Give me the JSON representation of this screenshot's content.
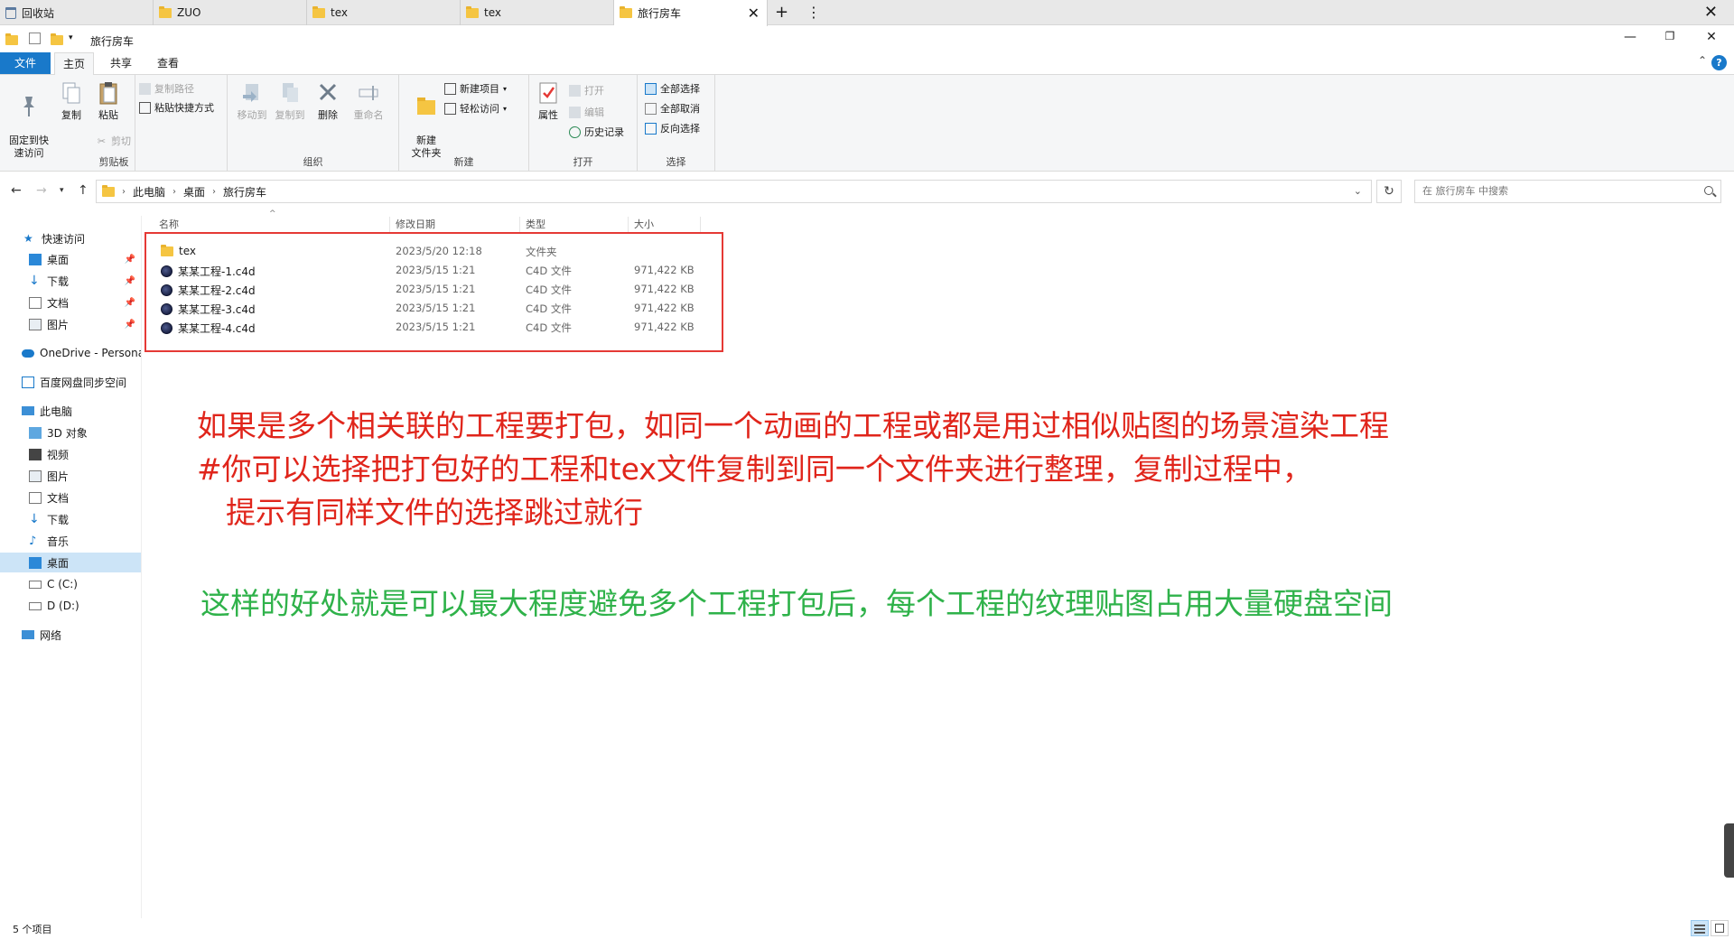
{
  "tabs": [
    {
      "label": "回收站",
      "icon": "recycle-bin-icon"
    },
    {
      "label": "ZUO",
      "icon": "folder-icon"
    },
    {
      "label": "tex",
      "icon": "folder-icon"
    },
    {
      "label": "tex",
      "icon": "folder-icon"
    },
    {
      "label": "旅行房车",
      "icon": "folder-icon",
      "active": true
    }
  ],
  "window": {
    "title": "旅行房车"
  },
  "ribbon_tabs": {
    "file": "文件",
    "home": "主页",
    "share": "共享",
    "view": "查看"
  },
  "ribbon": {
    "clipboard": {
      "pin": "固定到快\n速访问",
      "copy": "复制",
      "paste": "粘贴",
      "copy_path": "复制路径",
      "paste_shortcut": "粘贴快捷方式",
      "cut": "剪切",
      "label": "剪贴板"
    },
    "organize": {
      "move_to": "移动到",
      "copy_to": "复制到",
      "delete": "删除",
      "rename": "重命名",
      "label": "组织"
    },
    "new": {
      "new_folder": "新建\n文件夹",
      "new_item": "新建项目",
      "easy_access": "轻松访问",
      "label": "新建"
    },
    "open": {
      "properties": "属性",
      "open": "打开",
      "edit": "编辑",
      "history": "历史记录",
      "label": "打开"
    },
    "select": {
      "select_all": "全部选择",
      "select_none": "全部取消",
      "invert": "反向选择",
      "label": "选择"
    }
  },
  "address": {
    "crumbs": [
      "此电脑",
      "桌面",
      "旅行房车"
    ],
    "search_placeholder": "在 旅行房车 中搜索"
  },
  "nav_pane": {
    "quick_access": "快速访问",
    "quick_items": [
      "桌面",
      "下载",
      "文档",
      "图片"
    ],
    "onedrive": "OneDrive - Persona",
    "baidu": "百度网盘同步空间",
    "this_pc": "此电脑",
    "pc_items": [
      "3D 对象",
      "视频",
      "图片",
      "文档",
      "下载",
      "音乐",
      "桌面",
      "C (C:)",
      "D (D:)"
    ],
    "network": "网络"
  },
  "columns": {
    "name": "名称",
    "modified": "修改日期",
    "type": "类型",
    "size": "大小"
  },
  "files": [
    {
      "name": "tex",
      "modified": "2023/5/20 12:18",
      "type": "文件夹",
      "size": "",
      "icon": "folder-icon"
    },
    {
      "name": "某某工程-1.c4d",
      "modified": "2023/5/15 1:21",
      "type": "C4D 文件",
      "size": "971,422 KB",
      "icon": "c4d-file-icon"
    },
    {
      "name": "某某工程-2.c4d",
      "modified": "2023/5/15 1:21",
      "type": "C4D 文件",
      "size": "971,422 KB",
      "icon": "c4d-file-icon"
    },
    {
      "name": "某某工程-3.c4d",
      "modified": "2023/5/15 1:21",
      "type": "C4D 文件",
      "size": "971,422 KB",
      "icon": "c4d-file-icon"
    },
    {
      "name": "某某工程-4.c4d",
      "modified": "2023/5/15 1:21",
      "type": "C4D 文件",
      "size": "971,422 KB",
      "icon": "c4d-file-icon"
    }
  ],
  "annotations": {
    "line1": "如果是多个相关联的工程要打包，如同一个动画的工程或都是用过相似贴图的场景渲染工程",
    "line2": "#你可以选择把打包好的工程和tex文件复制到同一个文件夹进行整理，复制过程中，",
    "line3": "提示有同样文件的选择跳过就行",
    "line4": "这样的好处就是可以最大程度避免多个工程打包后，每个工程的纹理贴图占用大量硬盘空间",
    "red_color": "#e0251b",
    "green_color": "#2fb24a"
  },
  "status": {
    "count": "5 个项目"
  }
}
